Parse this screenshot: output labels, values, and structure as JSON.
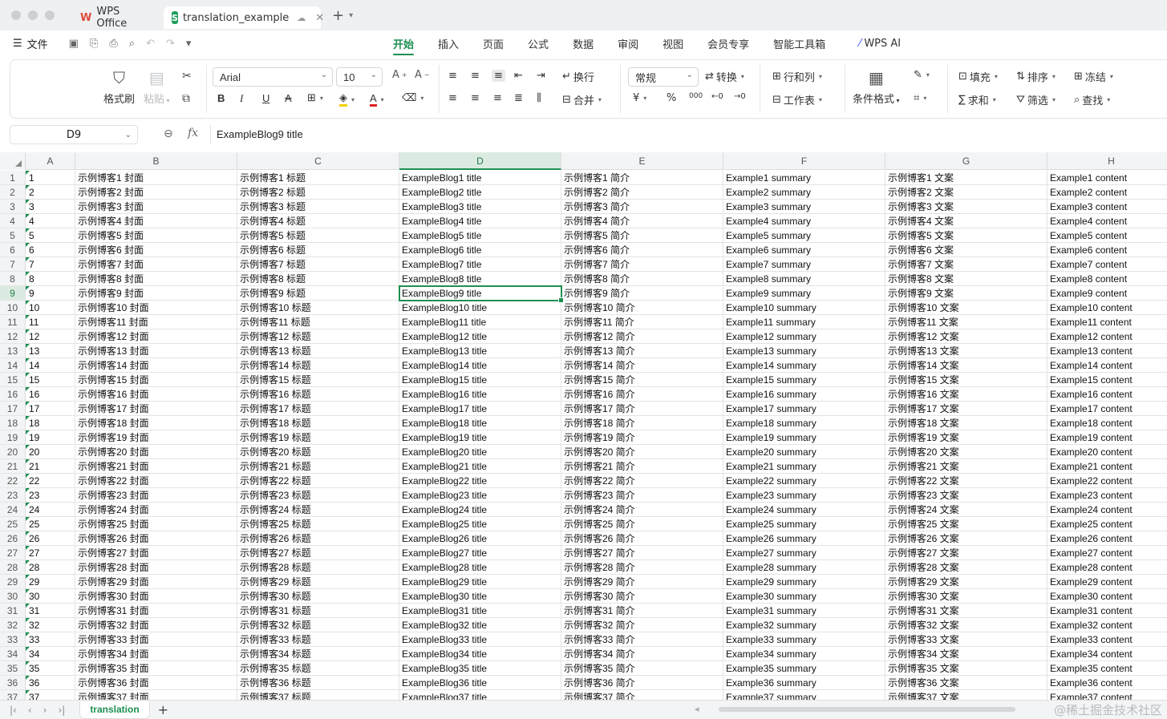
{
  "titlebar": {
    "tabs": [
      {
        "label": "WPS Office",
        "icon": "wps-logo-icon"
      },
      {
        "label": "translation_example",
        "icon": "spreadsheet-s-icon"
      }
    ],
    "sheet_logo_letter": "S",
    "wps_logo_letter": "W"
  },
  "menubar": {
    "file_label": "文件",
    "tabs": [
      "开始",
      "插入",
      "页面",
      "公式",
      "数据",
      "审阅",
      "视图",
      "会员专享",
      "智能工具箱"
    ],
    "active_tab": "开始",
    "ai_label": "WPS AI"
  },
  "ribbon": {
    "format_painter": "格式刷",
    "paste": "粘贴",
    "font": "Arial",
    "font_size": "10",
    "wrap": "换行",
    "merge": "合并",
    "number_format": "常规",
    "convert": "转换",
    "rows_cols": "行和列",
    "worksheet": "工作表",
    "conditional_format": "条件格式",
    "fill": "填充",
    "sort": "排序",
    "freeze": "冻结",
    "sum": "求和",
    "filter": "筛选",
    "find": "查找",
    "percent": "%",
    "thousands": "000"
  },
  "formula_bar": {
    "name_box": "D9",
    "fx": "fx",
    "content": "ExampleBlog9 title"
  },
  "grid": {
    "columns": [
      "A",
      "B",
      "C",
      "D",
      "E",
      "F",
      "G",
      "H"
    ],
    "selected_column": "D",
    "selected_row": 9,
    "row_count": 37
  },
  "sheets": {
    "tabs": [
      "translation"
    ]
  },
  "watermark": "@稀土掘金技术社区",
  "colors": {
    "accent": "#1e8f52"
  }
}
